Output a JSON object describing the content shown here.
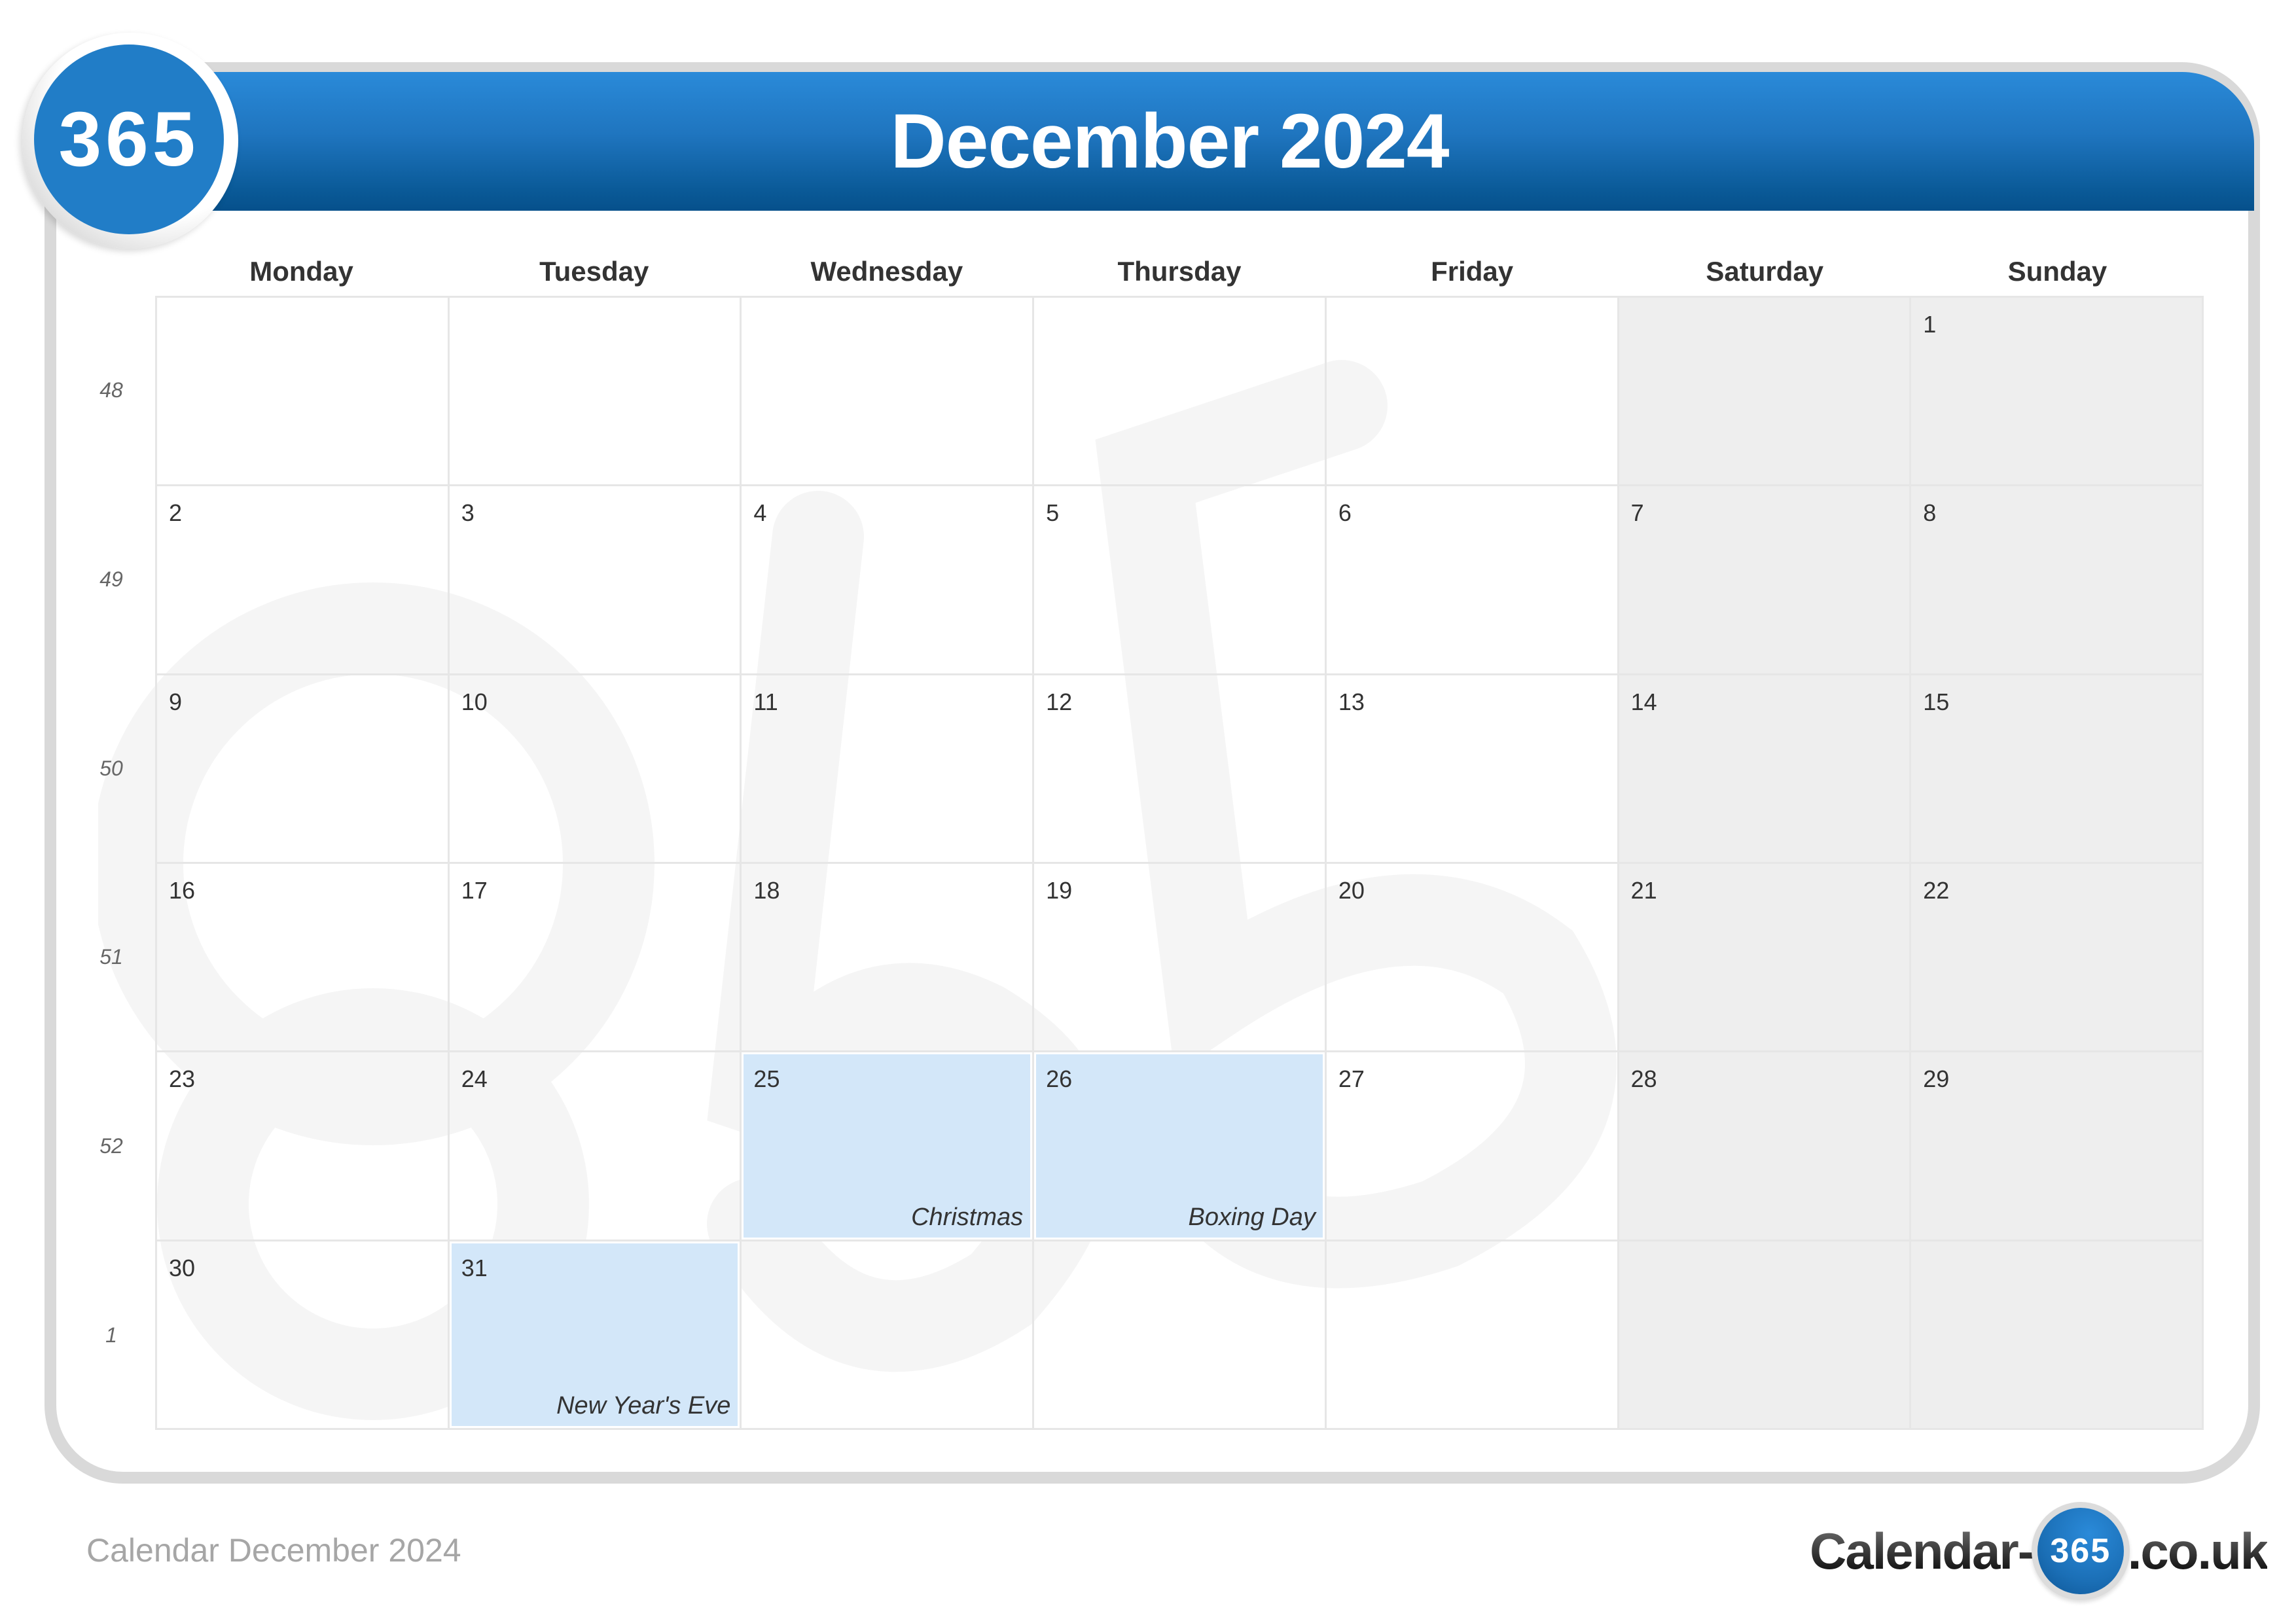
{
  "header": {
    "logo_text": "365",
    "title": "December 2024"
  },
  "weekdays": [
    "Monday",
    "Tuesday",
    "Wednesday",
    "Thursday",
    "Friday",
    "Saturday",
    "Sunday"
  ],
  "week_numbers": [
    "48",
    "49",
    "50",
    "51",
    "52",
    "1"
  ],
  "weeks": [
    [
      {
        "day": ""
      },
      {
        "day": ""
      },
      {
        "day": ""
      },
      {
        "day": ""
      },
      {
        "day": ""
      },
      {
        "day": ""
      },
      {
        "day": "1"
      }
    ],
    [
      {
        "day": "2"
      },
      {
        "day": "3"
      },
      {
        "day": "4"
      },
      {
        "day": "5"
      },
      {
        "day": "6"
      },
      {
        "day": "7"
      },
      {
        "day": "8"
      }
    ],
    [
      {
        "day": "9"
      },
      {
        "day": "10"
      },
      {
        "day": "11"
      },
      {
        "day": "12"
      },
      {
        "day": "13"
      },
      {
        "day": "14"
      },
      {
        "day": "15"
      }
    ],
    [
      {
        "day": "16"
      },
      {
        "day": "17"
      },
      {
        "day": "18"
      },
      {
        "day": "19"
      },
      {
        "day": "20"
      },
      {
        "day": "21"
      },
      {
        "day": "22"
      }
    ],
    [
      {
        "day": "23"
      },
      {
        "day": "24"
      },
      {
        "day": "25",
        "holiday": "Christmas"
      },
      {
        "day": "26",
        "holiday": "Boxing Day"
      },
      {
        "day": "27"
      },
      {
        "day": "28"
      },
      {
        "day": "29"
      }
    ],
    [
      {
        "day": "30"
      },
      {
        "day": "31",
        "holiday": "New Year's Eve"
      },
      {
        "day": ""
      },
      {
        "day": ""
      },
      {
        "day": ""
      },
      {
        "day": ""
      },
      {
        "day": ""
      }
    ]
  ],
  "colors": {
    "header_blue": "#1f75bf",
    "holiday_fill": "#d3e7f9",
    "weekend_fill": "#efefef"
  },
  "footer": {
    "caption": "Calendar December 2024",
    "brand_prefix": "Calendar-",
    "brand_badge": "365",
    "brand_suffix": ".co.uk"
  }
}
